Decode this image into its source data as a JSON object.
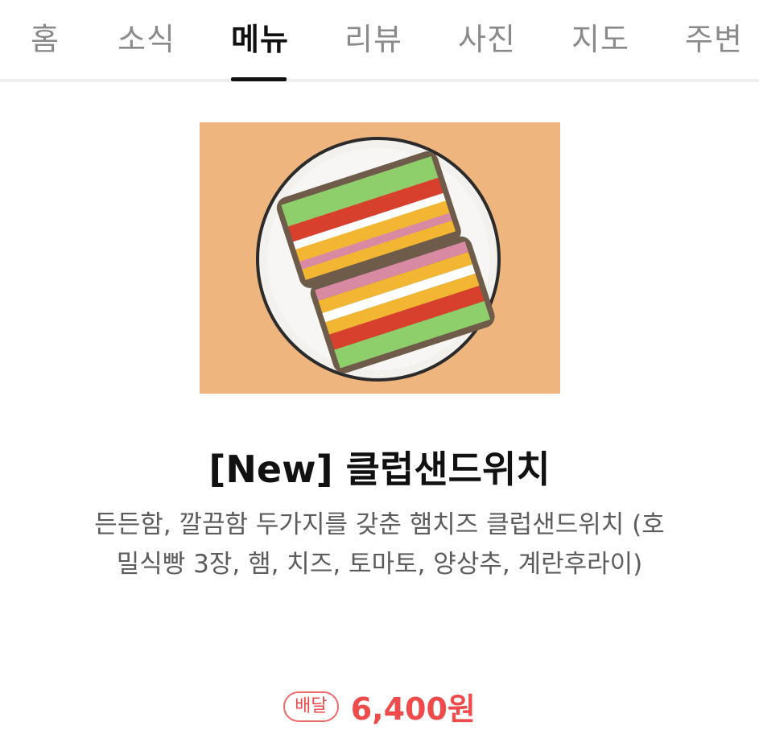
{
  "tabs": [
    {
      "label": "홈",
      "active": false
    },
    {
      "label": "소식",
      "active": false
    },
    {
      "label": "메뉴",
      "active": true
    },
    {
      "label": "리뷰",
      "active": false
    },
    {
      "label": "사진",
      "active": false
    },
    {
      "label": "지도",
      "active": false
    },
    {
      "label": "주변",
      "active": false
    }
  ],
  "menu": {
    "name": "[New] 클럽샌드위치",
    "description": "든든함, 깔끔함 두가지를 갖춘 햄치즈 클럽샌드위치 (호밀식빵 3장, 햄, 치즈, 토마토, 양상추, 계란후라이)",
    "delivery_badge": "배달",
    "price": "6,400원"
  },
  "colors": {
    "accent_price": "#ef4b4b",
    "photo_background": "#efb57e"
  }
}
